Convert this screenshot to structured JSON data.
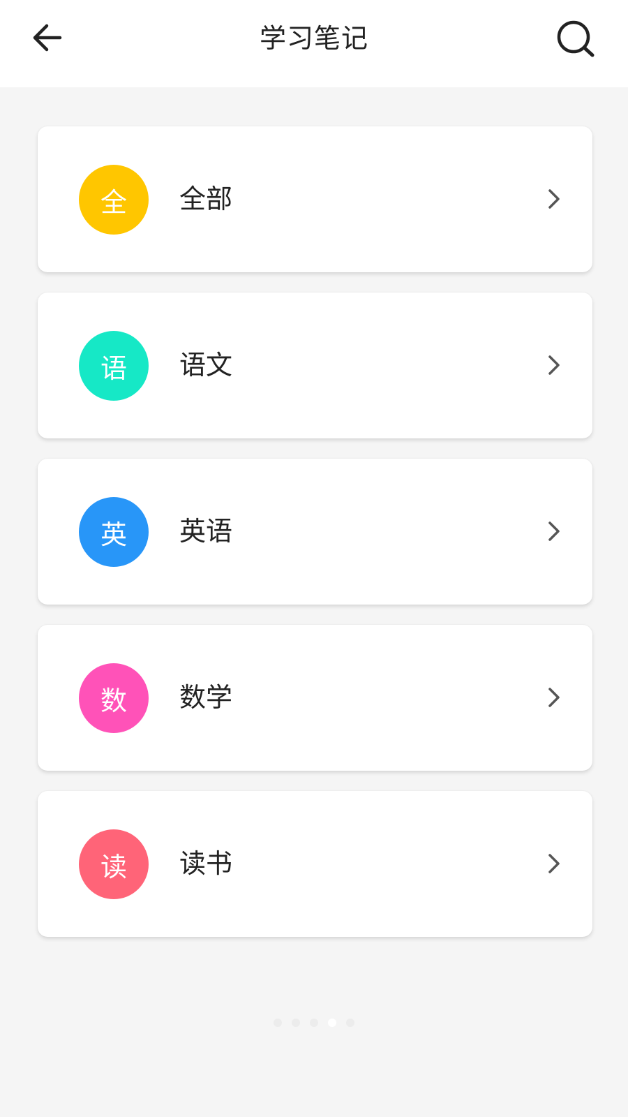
{
  "header": {
    "title": "学习笔记",
    "back_icon": "arrow-left-icon",
    "search_icon": "search-icon"
  },
  "categories": [
    {
      "badge": "全",
      "label": "全部",
      "color": "#FFC600"
    },
    {
      "badge": "语",
      "label": "语文",
      "color": "#16E8C6"
    },
    {
      "badge": "英",
      "label": "英语",
      "color": "#2896F8"
    },
    {
      "badge": "数",
      "label": "数学",
      "color": "#FF52B8"
    },
    {
      "badge": "读",
      "label": "读书",
      "color": "#FF6478"
    }
  ],
  "pager": {
    "count": 5,
    "active_index": 3
  },
  "colors": {
    "background": "#f5f5f5",
    "header": "#ffffff",
    "text": "#222222"
  }
}
